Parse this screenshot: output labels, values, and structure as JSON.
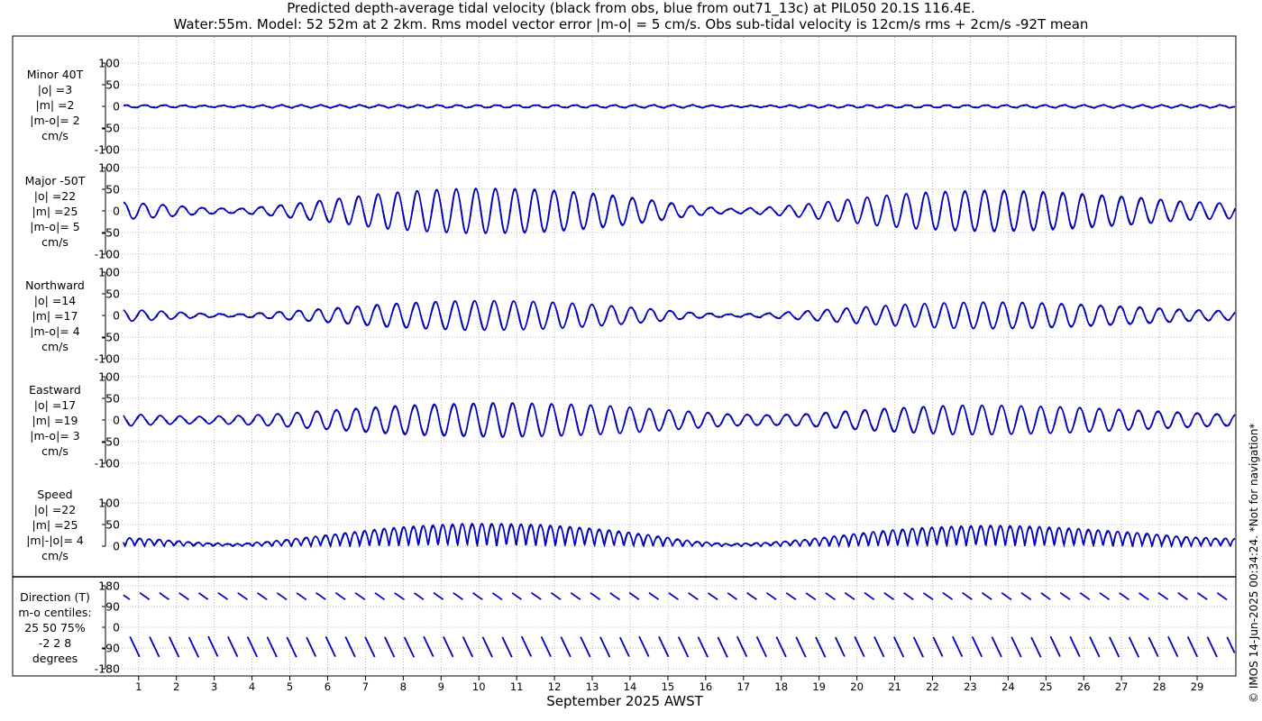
{
  "title": {
    "line1": "Predicted depth-average tidal velocity (black from obs, blue from out71_13c) at PIL050 20.1S 116.4E.",
    "line2": "Water:55m. Model: 52 52m at 2 2km. Rms model vector error |m-o| = 5 cm/s. Obs sub-tidal velocity is 12cm/s rms + 2cm/s -92T mean"
  },
  "copyright": "© IMOS 14-Jun-2025 00:34:24. *Not for navigation*",
  "colors": {
    "obs": "#000000",
    "model": "#0000cc",
    "grid": "#b4b4b4"
  },
  "chart_data": [
    {
      "type": "line",
      "panel": "Minor 40T",
      "labels": [
        "Minor 40T",
        "|o| =3",
        "|m| =2",
        "|m-o|= 2",
        "cm/s"
      ],
      "ylim": [
        -100,
        100
      ],
      "yticks": [
        100,
        50,
        0,
        -50,
        -100
      ],
      "amplitude_envelope": [
        3,
        3,
        2,
        2,
        3,
        3,
        3,
        3,
        3,
        3,
        3,
        3,
        3,
        3,
        3,
        3,
        2,
        2,
        3,
        3,
        3,
        3,
        3,
        3,
        3,
        3,
        3,
        3,
        3,
        3
      ],
      "series": [
        {
          "name": "obs",
          "color": "#000000"
        },
        {
          "name": "model",
          "color": "#0000cc"
        }
      ]
    },
    {
      "type": "line",
      "panel": "Major -50T",
      "labels": [
        "Major -50T",
        "|o| =22",
        "|m| =25",
        "|m-o|= 5",
        "cm/s"
      ],
      "ylim": [
        -100,
        100
      ],
      "yticks": [
        100,
        50,
        0,
        -50,
        -100
      ],
      "amplitude_envelope": [
        20,
        15,
        8,
        5,
        12,
        22,
        32,
        42,
        48,
        52,
        52,
        50,
        44,
        36,
        25,
        12,
        5,
        8,
        15,
        25,
        35,
        42,
        46,
        48,
        46,
        42,
        36,
        30,
        22,
        18
      ],
      "series": [
        {
          "name": "obs",
          "color": "#000000"
        },
        {
          "name": "model",
          "color": "#0000cc"
        }
      ]
    },
    {
      "type": "line",
      "panel": "Northward",
      "labels": [
        "Northward",
        "|o| =14",
        "|m| =17",
        "|m-o|= 4",
        "cm/s"
      ],
      "ylim": [
        -100,
        100
      ],
      "yticks": [
        100,
        50,
        0,
        -50,
        -100
      ],
      "amplitude_envelope": [
        14,
        10,
        5,
        3,
        8,
        14,
        20,
        27,
        31,
        34,
        34,
        32,
        28,
        22,
        15,
        7,
        3,
        5,
        10,
        16,
        22,
        27,
        30,
        31,
        30,
        27,
        23,
        19,
        14,
        11
      ],
      "series": [
        {
          "name": "obs",
          "color": "#000000"
        },
        {
          "name": "model",
          "color": "#0000cc"
        }
      ]
    },
    {
      "type": "line",
      "panel": "Eastward",
      "labels": [
        "Eastward",
        "|o| =17",
        "|m| =19",
        "|m-o|= 3",
        "cm/s"
      ],
      "ylim": [
        -100,
        100
      ],
      "yticks": [
        100,
        50,
        0,
        -50,
        -100
      ],
      "amplitude_envelope": [
        14,
        10,
        8,
        10,
        14,
        20,
        26,
        32,
        36,
        38,
        40,
        38,
        36,
        32,
        26,
        20,
        14,
        12,
        14,
        20,
        26,
        30,
        34,
        34,
        32,
        30,
        26,
        22,
        18,
        14
      ],
      "series": [
        {
          "name": "obs",
          "color": "#000000"
        },
        {
          "name": "model",
          "color": "#0000cc"
        }
      ]
    },
    {
      "type": "line",
      "panel": "Speed",
      "labels": [
        "Speed",
        "|o| =22",
        "|m| =25",
        "|m|-|o|= 4",
        "cm/s"
      ],
      "ylim": [
        0,
        100
      ],
      "yticks": [
        100,
        50,
        0
      ],
      "amplitude_envelope": [
        20,
        15,
        8,
        5,
        12,
        22,
        32,
        42,
        48,
        52,
        52,
        50,
        44,
        36,
        25,
        12,
        5,
        8,
        15,
        25,
        35,
        42,
        46,
        48,
        46,
        42,
        36,
        30,
        22,
        18
      ],
      "series": [
        {
          "name": "obs",
          "color": "#000000"
        },
        {
          "name": "model",
          "color": "#0000cc"
        }
      ]
    },
    {
      "type": "line",
      "panel": "Direction (T)",
      "labels": [
        "Direction (T)",
        "m-o centiles:",
        "25  50  75%",
        "-2  2  8",
        "degrees"
      ],
      "ylim": [
        -180,
        180
      ],
      "yticks": [
        180,
        90,
        0,
        -90,
        -180
      ],
      "series": [
        {
          "name": "obs",
          "color": "#000000"
        },
        {
          "name": "model",
          "color": "#0000cc"
        }
      ]
    }
  ],
  "xaxis": {
    "title": "September 2025 AWST",
    "tick_labels": [
      "1",
      "2",
      "3",
      "4",
      "5",
      "6",
      "7",
      "8",
      "9",
      "10",
      "11",
      "12",
      "13",
      "14",
      "15",
      "16",
      "17",
      "18",
      "19",
      "20",
      "21",
      "22",
      "23",
      "24",
      "25",
      "26",
      "27",
      "28",
      "29"
    ],
    "xlim_days": [
      0.6,
      30.0
    ]
  }
}
